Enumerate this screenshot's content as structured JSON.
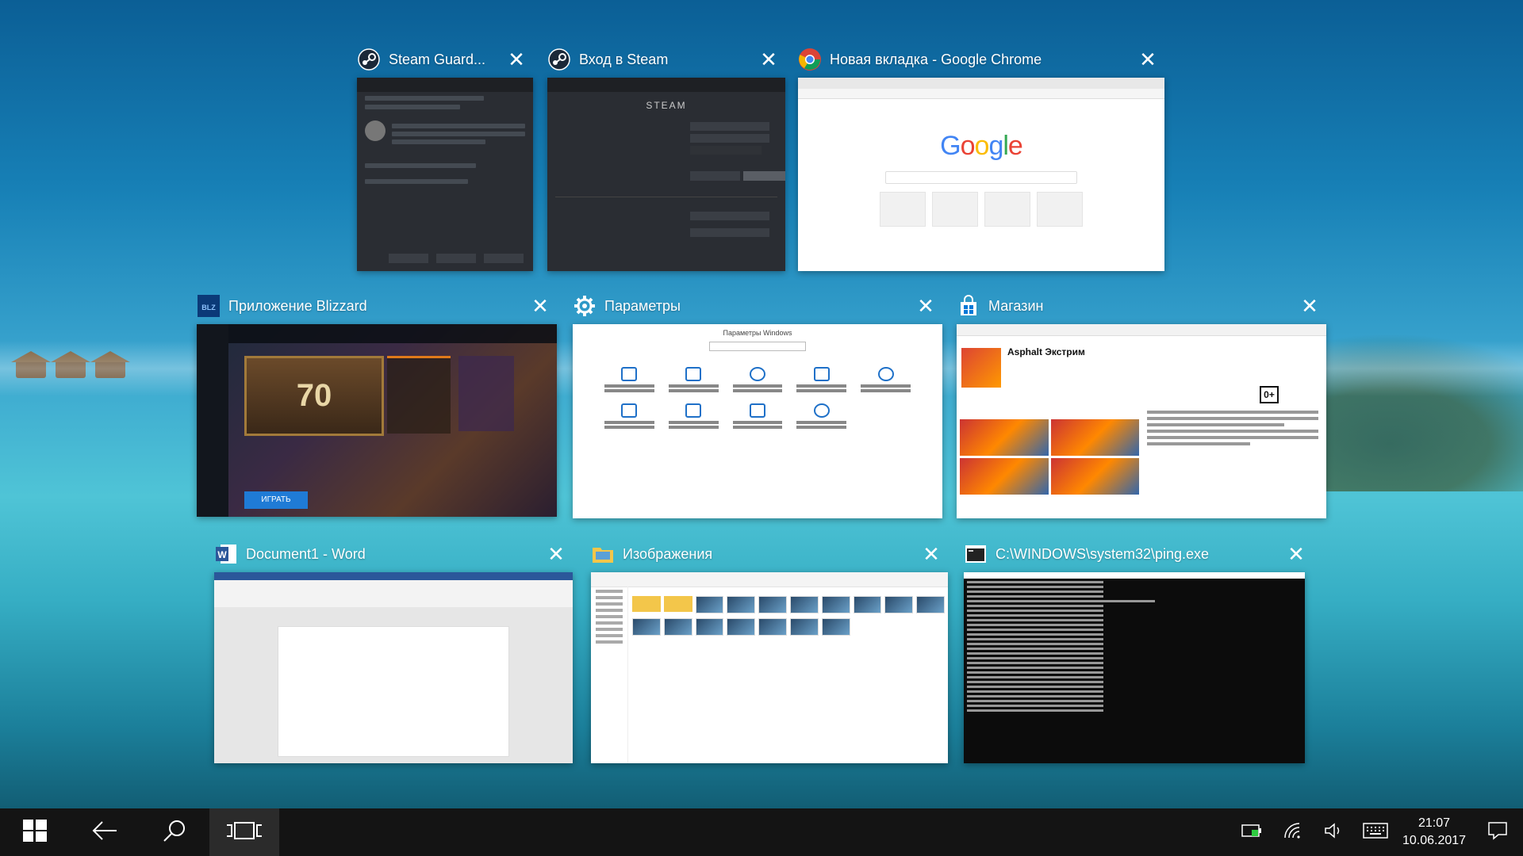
{
  "windows": [
    {
      "title": "Steam Guard...",
      "icon": "steam-icon"
    },
    {
      "title": "Вход в Steam",
      "icon": "steam-icon"
    },
    {
      "title": "Новая вкладка - Google Chrome",
      "icon": "chrome-icon"
    },
    {
      "title": "Приложение Blizzard",
      "icon": "blizzard-icon"
    },
    {
      "title": "Параметры",
      "icon": "gear-icon"
    },
    {
      "title": "Магазин",
      "icon": "store-icon"
    },
    {
      "title": "Document1 - Word",
      "icon": "word-icon"
    },
    {
      "title": "Изображения",
      "icon": "folder-icon"
    },
    {
      "title": "C:\\WINDOWS\\system32\\ping.exe",
      "icon": "console-icon"
    }
  ],
  "close_glyph": "✕",
  "thumbs": {
    "steam_login_brand": "STEAM",
    "google_logo": "Google",
    "blizzard_number": "70",
    "blizzard_play": "ИГРАТЬ",
    "settings_title": "Параметры Windows",
    "store_app": "Asphalt Экстрим",
    "store_age": "0+"
  },
  "taskbar": {
    "time": "21:07",
    "date": "10.06.2017"
  },
  "colors": {
    "taskbar_bg": "#141414",
    "accent_blue": "#1e70c8"
  }
}
